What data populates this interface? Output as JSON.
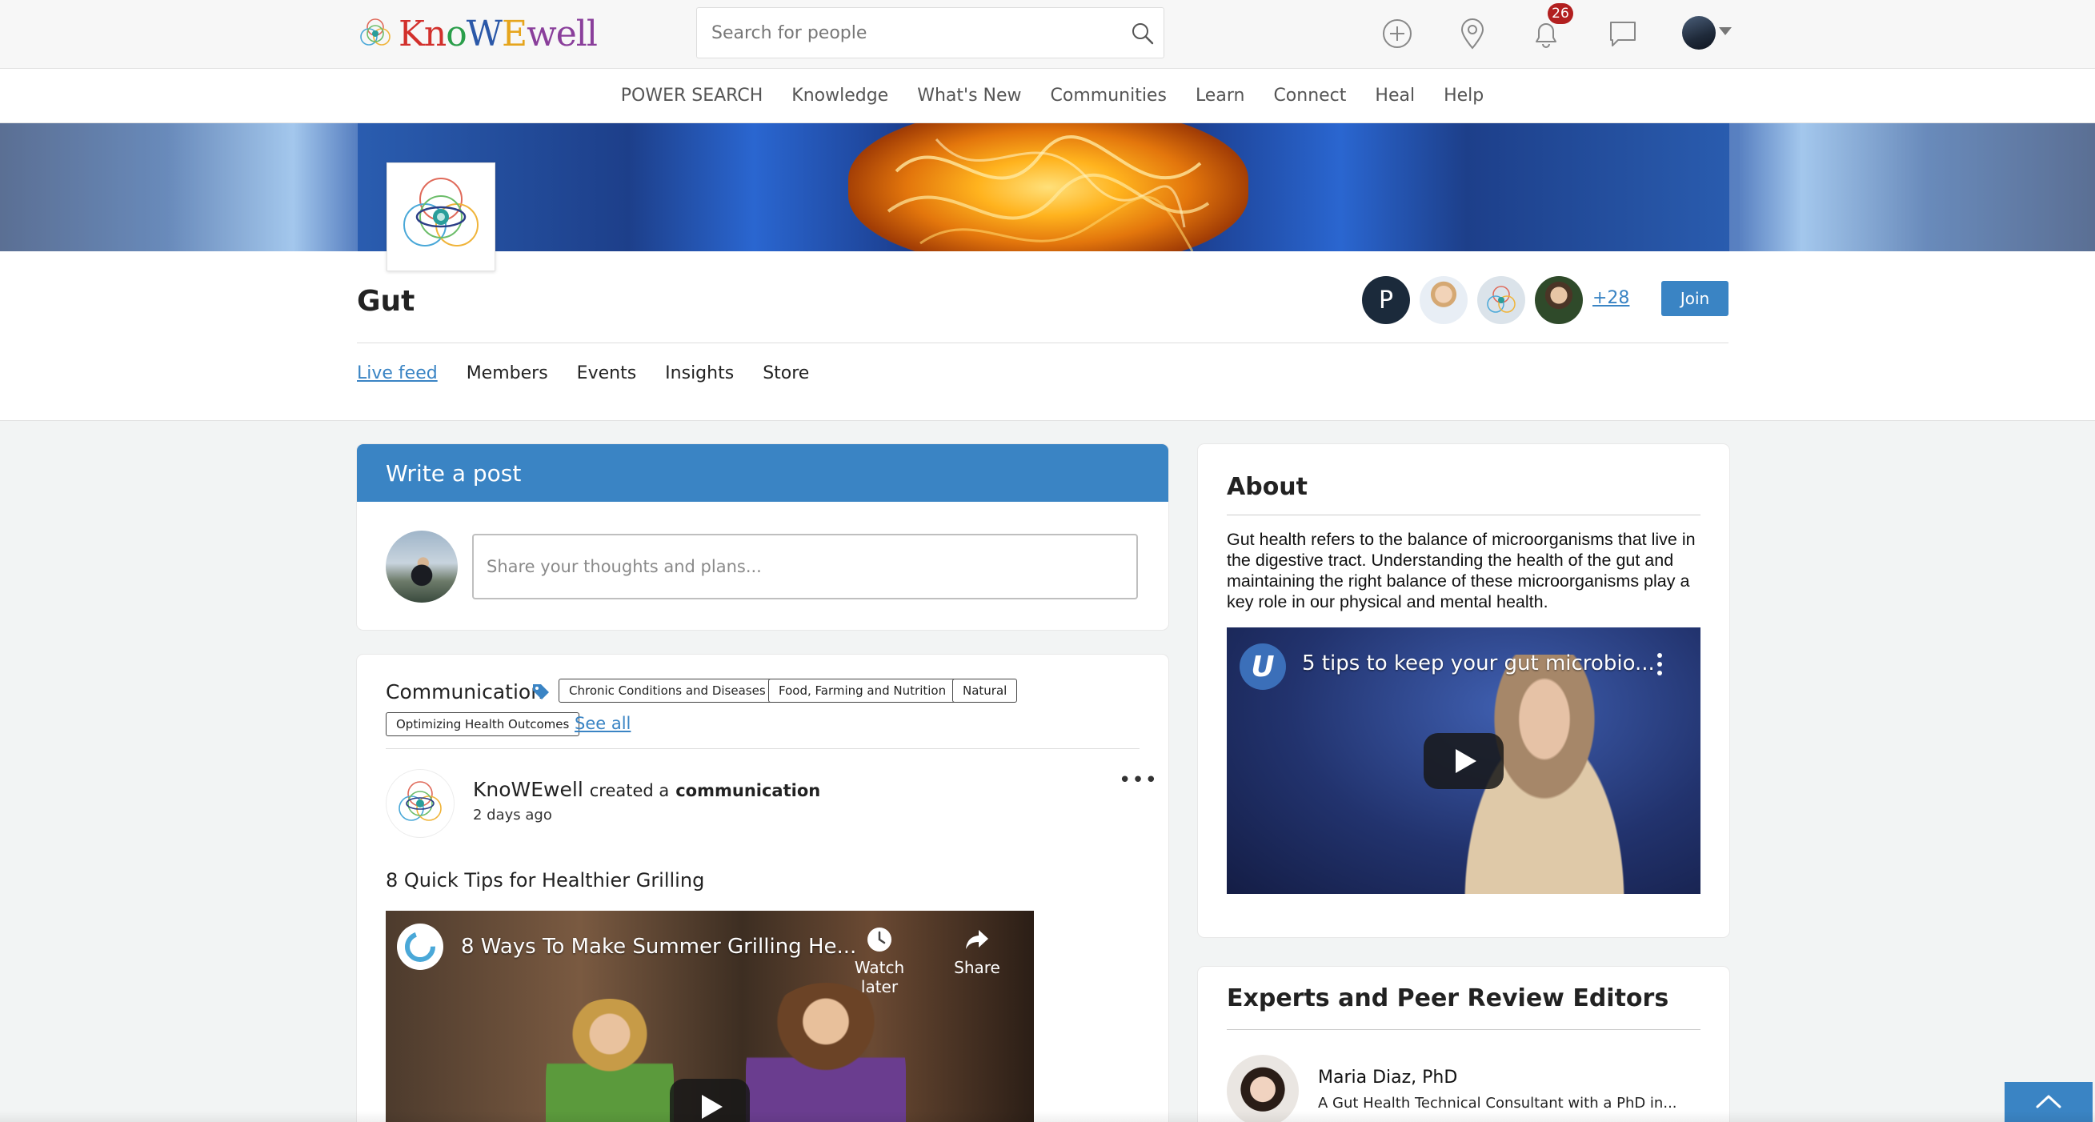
{
  "header": {
    "logo": {
      "k": "K",
      "n": "n",
      "o": "o",
      "w": "W",
      "e": "E",
      "well": "well"
    },
    "search_placeholder": "Search for people",
    "notifications_count": "26"
  },
  "nav": {
    "items": [
      "POWER SEARCH",
      "Knowledge",
      "What's New",
      "Communities",
      "Learn",
      "Connect",
      "Heal",
      "Help"
    ]
  },
  "group": {
    "title": "Gut",
    "member_initial": "P",
    "more_members": "+28",
    "join_label": "Join",
    "tabs": [
      "Live feed",
      "Members",
      "Events",
      "Insights",
      "Store"
    ]
  },
  "write_post": {
    "title": "Write a post",
    "placeholder": "Share your thoughts and plans..."
  },
  "feed": {
    "category": "Communication",
    "tags": [
      "Chronic Conditions and Diseases",
      "Food, Farming and Nutrition",
      "Natural",
      "Optimizing Health Outcomes"
    ],
    "see_all": "See all",
    "post": {
      "author": "KnoWEwell",
      "verb": "created a",
      "object": "communication",
      "time": "2 days ago",
      "title": "8 Quick Tips for Healthier Grilling",
      "video_title": "8 Ways To Make Summer Grilling He...",
      "watch_later": "Watch later",
      "share": "Share"
    }
  },
  "about": {
    "title": "About",
    "text": "Gut health refers to the balance of microorganisms that live in the digestive tract. Understanding the health of the gut and maintaining the right balance of these microorganisms play a key role in our physical and mental health.",
    "video_title": "5 tips to keep your gut microbio...",
    "video_channel_letter": "U"
  },
  "experts": {
    "title": "Experts and Peer Review Editors",
    "items": [
      {
        "name": "Maria Diaz, PhD",
        "desc": "A Gut Health Technical Consultant with a PhD in..."
      }
    ]
  },
  "colors": {
    "primary": "#3a84c4",
    "badge": "#b21f1f",
    "page_bg": "#f2f4f4"
  }
}
